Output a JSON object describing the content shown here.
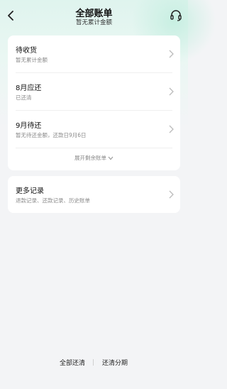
{
  "header": {
    "title": "全部账单",
    "subtitle": "暂无累计金额"
  },
  "bills": [
    {
      "title": "待收货",
      "subtitle": "暂无累计金额"
    },
    {
      "title": "8月应还",
      "subtitle": "已还清"
    },
    {
      "title": "9月待还",
      "subtitle": "暂无待还金额，还款日9月6日"
    }
  ],
  "expand_label": "展开剩余账单",
  "more": {
    "title": "更多记录",
    "subtitle": "退款记录、还款记录、历史账单"
  },
  "bottom": {
    "repay_all": "全部还清",
    "repay_installment": "还清分期"
  },
  "icons": {
    "back": "back-arrow-icon",
    "support": "headset-icon",
    "chevron": "chevron-right-icon",
    "expand": "chevron-down-icon"
  },
  "colors": {
    "header_tint": "#dff4ee",
    "background": "#f3f4f6"
  }
}
